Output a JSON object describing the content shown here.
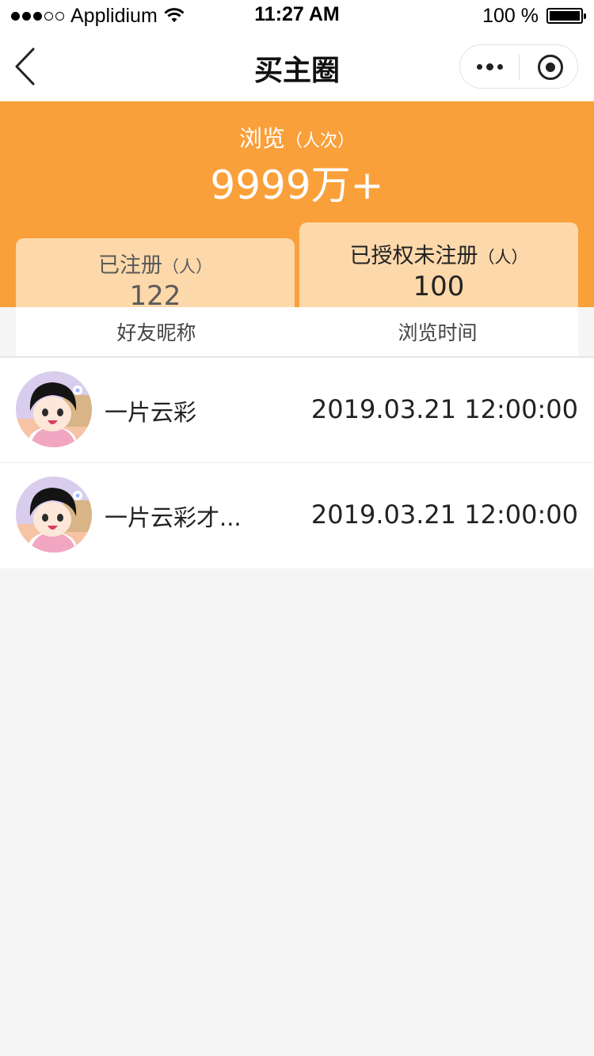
{
  "status_bar": {
    "carrier": "Applidium",
    "time": "11:27 AM",
    "battery": "100 %"
  },
  "nav": {
    "title": "买主圈"
  },
  "summary": {
    "browse_label": "浏览",
    "browse_unit": "（人次）",
    "browse_value": "9999万+",
    "registered_label": "已注册",
    "registered_unit": "（人）",
    "registered_value": "122",
    "authorized_label": "已授权未注册",
    "authorized_unit": "（人）",
    "authorized_value": "100"
  },
  "table": {
    "headers": [
      "好友昵称",
      "浏览时间"
    ],
    "rows": [
      {
        "name": "一片云彩",
        "time": "2019.03.21 12:00:00"
      },
      {
        "name": "一片云彩才...",
        "time": "2019.03.21 12:00:00"
      }
    ]
  },
  "colors": {
    "accent": "#f9a03a",
    "card": "#fcd8aa"
  }
}
